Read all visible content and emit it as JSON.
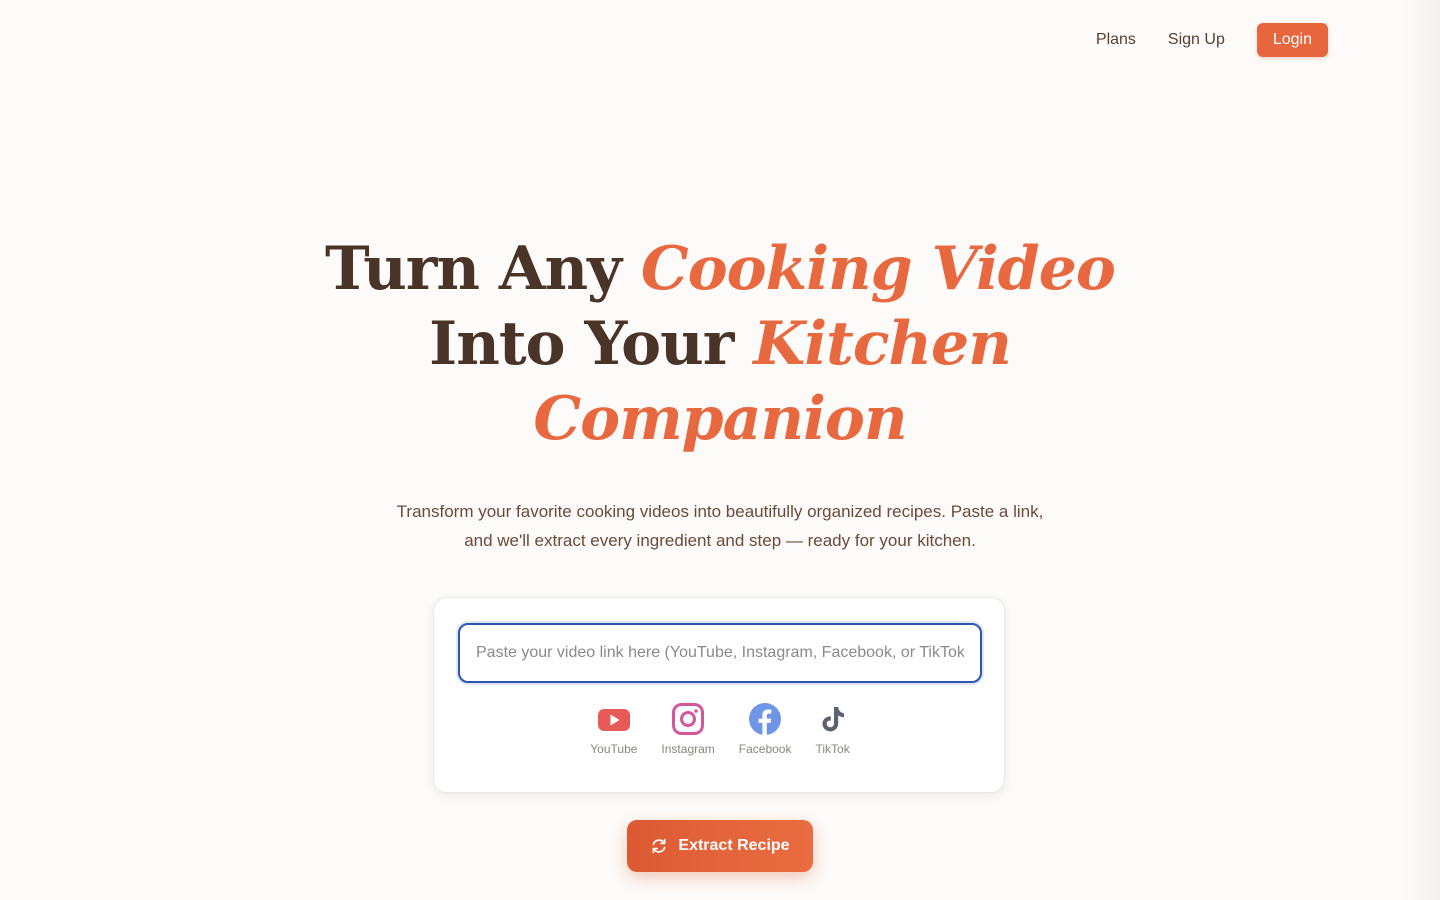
{
  "nav": {
    "plans": "Plans",
    "signup": "Sign Up",
    "login": "Login"
  },
  "hero": {
    "line1_plain": "Turn Any ",
    "line1_accent": "Cooking Video",
    "line2_plain": "Into Your ",
    "line2_accent": "Kitchen",
    "line3_accent": "Companion",
    "subtitle": "Transform your favorite cooking videos into beautifully organized recipes. Paste a link, and we'll extract every ingredient and step — ready for your kitchen."
  },
  "input": {
    "placeholder": "Paste your video link here (YouTube, Instagram, Facebook, or TikTok)",
    "value": ""
  },
  "platforms": [
    {
      "label": "YouTube",
      "icon": "youtube-icon",
      "color": "#e85a5a"
    },
    {
      "label": "Instagram",
      "icon": "instagram-icon",
      "color": "#d4579a"
    },
    {
      "label": "Facebook",
      "icon": "facebook-icon",
      "color": "#6f94e8"
    },
    {
      "label": "TikTok",
      "icon": "tiktok-icon",
      "color": "#5d6270"
    }
  ],
  "extract_button": {
    "label": "Extract Recipe",
    "icon": "refresh-icon"
  },
  "colors": {
    "accent": "#e8663d",
    "heading": "#4a3428",
    "focus": "#2d56b3"
  }
}
